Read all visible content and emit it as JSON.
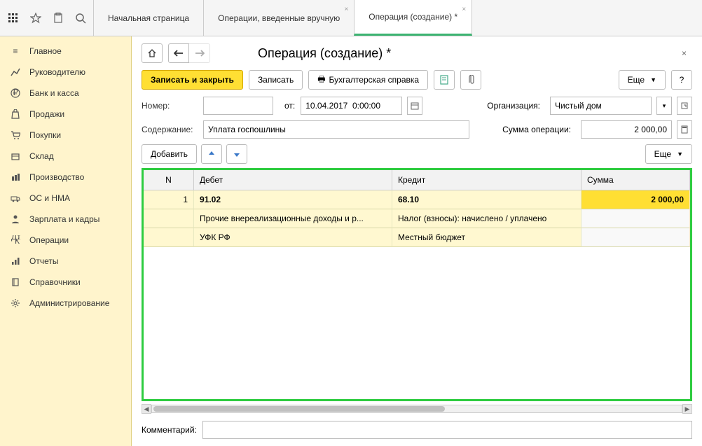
{
  "top": {
    "tabs": [
      {
        "label": "Начальная страница",
        "active": false,
        "closable": false
      },
      {
        "label": "Операции, введенные вручную",
        "active": false,
        "closable": true
      },
      {
        "label": "Операция (создание) *",
        "active": true,
        "closable": true
      }
    ]
  },
  "sidebar": {
    "items": [
      {
        "label": "Главное",
        "icon": "menu-icon"
      },
      {
        "label": "Руководителю",
        "icon": "chart-icon"
      },
      {
        "label": "Банк и касса",
        "icon": "ruble-icon"
      },
      {
        "label": "Продажи",
        "icon": "bag-icon"
      },
      {
        "label": "Покупки",
        "icon": "cart-icon"
      },
      {
        "label": "Склад",
        "icon": "box-icon"
      },
      {
        "label": "Производство",
        "icon": "factory-icon"
      },
      {
        "label": "ОС и НМА",
        "icon": "truck-icon"
      },
      {
        "label": "Зарплата и кадры",
        "icon": "person-icon"
      },
      {
        "label": "Операции",
        "icon": "operation-icon"
      },
      {
        "label": "Отчеты",
        "icon": "report-icon"
      },
      {
        "label": "Справочники",
        "icon": "book-icon"
      },
      {
        "label": "Администрирование",
        "icon": "gear-icon"
      }
    ]
  },
  "page": {
    "title": "Операция (создание) *"
  },
  "toolbar": {
    "save_close": "Записать и закрыть",
    "save": "Записать",
    "print_ref": "Бухгалтерская справка",
    "more": "Еще",
    "help": "?"
  },
  "form": {
    "number_label": "Номер:",
    "number_value": "",
    "date_label": "от:",
    "date_value": "10.04.2017  0:00:00",
    "org_label": "Организация:",
    "org_value": "Чистый дом",
    "content_label": "Содержание:",
    "content_value": "Уплата госпошлины",
    "sum_label": "Сумма операции:",
    "sum_value": "2 000,00",
    "comment_label": "Комментарий:",
    "comment_value": ""
  },
  "table_toolbar": {
    "add": "Добавить",
    "more": "Еще"
  },
  "table": {
    "columns": {
      "n": "N",
      "debit": "Дебет",
      "credit": "Кредит",
      "sum": "Сумма"
    },
    "rows": [
      {
        "n": "1",
        "debit1": "91.02",
        "credit1": "68.10",
        "sum": "2 000,00",
        "debit2": "Прочие внереализационные доходы и р...",
        "credit2": "Налог (взносы): начислено / уплачено",
        "debit3": "УФК РФ",
        "credit3": "Местный бюджет"
      }
    ]
  }
}
